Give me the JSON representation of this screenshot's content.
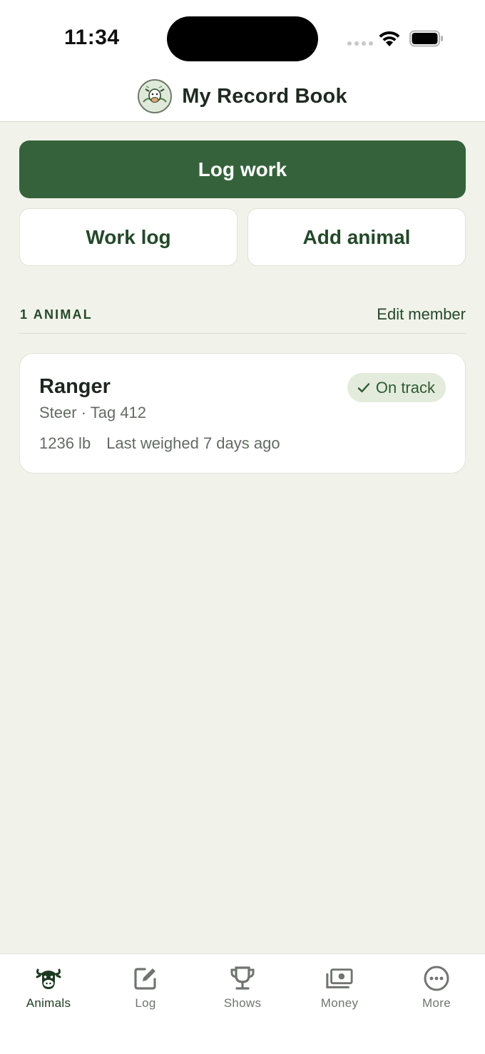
{
  "status_bar": {
    "time": "11:34"
  },
  "header": {
    "title": "My Record Book",
    "logo_icon": "cow-logo-icon"
  },
  "actions": {
    "primary_label": "Log work",
    "work_log_label": "Work log",
    "add_animal_label": "Add animal"
  },
  "section": {
    "count_label": "1 ANIMAL",
    "edit_label": "Edit member"
  },
  "animals": [
    {
      "name": "Ranger",
      "subtitle": "Steer · Tag 412",
      "weight": "1236 lb",
      "last_weighed": "Last weighed 7 days ago",
      "status": "On track",
      "status_icon": "checkmark-icon"
    }
  ],
  "tabs": [
    {
      "label": "Animals",
      "icon": "cow-icon",
      "active": true
    },
    {
      "label": "Log",
      "icon": "edit-icon",
      "active": false
    },
    {
      "label": "Shows",
      "icon": "trophy-icon",
      "active": false
    },
    {
      "label": "Money",
      "icon": "money-icon",
      "active": false
    },
    {
      "label": "More",
      "icon": "more-icon",
      "active": false
    }
  ],
  "colors": {
    "primary": "#35623b",
    "background": "#f1f2ea",
    "badge_bg": "#e3ecdc",
    "text_dark": "#1e2620",
    "text_muted": "#626b62"
  }
}
